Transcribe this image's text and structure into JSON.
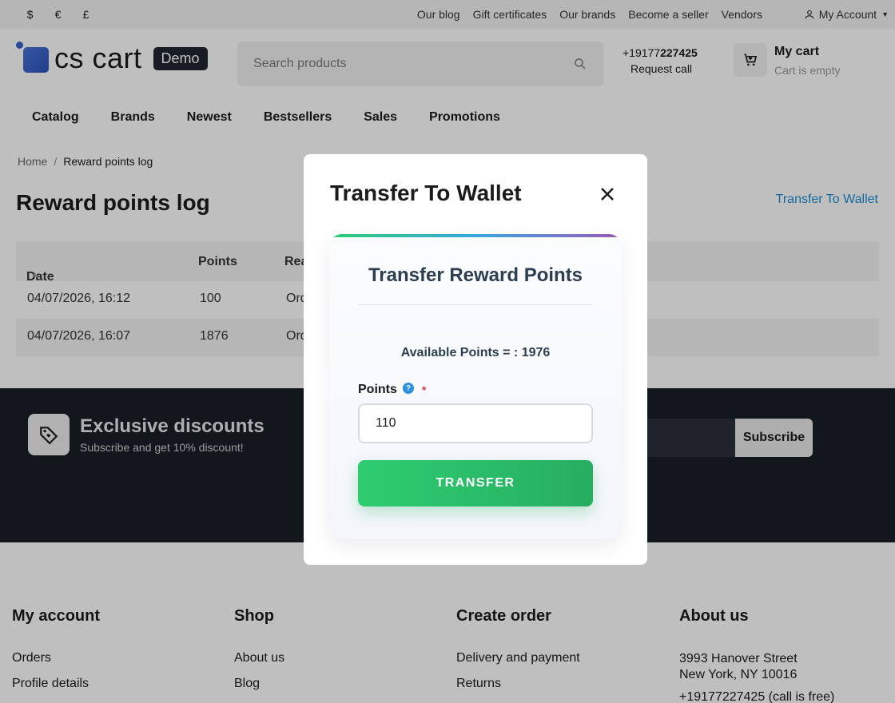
{
  "topbar": {
    "currencies": [
      "$",
      "€",
      "£"
    ],
    "links": [
      "Our blog",
      "Gift certificates",
      "Our brands",
      "Become a seller",
      "Vendors"
    ],
    "account_label": "My Account"
  },
  "header": {
    "logo_text": "cs cart",
    "logo_badge": "Demo",
    "search_placeholder": "Search products",
    "phone_prefix": "+19177",
    "phone_bold": "227425",
    "request_call": "Request call",
    "cart_title": "My cart",
    "cart_status": "Cart is empty"
  },
  "nav": [
    "Catalog",
    "Brands",
    "Newest",
    "Bestsellers",
    "Sales",
    "Promotions"
  ],
  "breadcrumb": {
    "home": "Home",
    "separator": "/",
    "current": "Reward points log"
  },
  "page": {
    "title": "Reward points log",
    "transfer_link": "Transfer To Wallet"
  },
  "table": {
    "headers": {
      "date": "Date",
      "points": "Points",
      "reason": "Rea"
    },
    "rows": [
      {
        "date": "04/07/2026, 16:12",
        "points": "100",
        "reason": "Ord"
      },
      {
        "date": "04/07/2026, 16:07",
        "points": "1876",
        "reason": "Ord"
      }
    ]
  },
  "newsletter": {
    "title": "Exclusive discounts",
    "subtitle": "Subscribe and get 10% discount!",
    "button": "Subscribe"
  },
  "footer": {
    "col1": {
      "title": "My account",
      "links": [
        "Orders",
        "Profile details"
      ]
    },
    "col2": {
      "title": "Shop",
      "links": [
        "About us",
        "Blog"
      ]
    },
    "col3": {
      "title": "Create order",
      "links": [
        "Delivery and payment",
        "Returns"
      ]
    },
    "col4": {
      "title": "About us",
      "address1": "3993 Hanover Street",
      "address2": "New York, NY 10016",
      "phone": "+19177227425 (call is free)"
    }
  },
  "modal": {
    "title": "Transfer To Wallet",
    "card_title": "Transfer Reward Points",
    "available": "Available Points = : 1976",
    "points_label": "Points",
    "help": "?",
    "required_mark": "*",
    "points_value": "110",
    "transfer_button": "TRANSFER"
  },
  "colors": {
    "accent_link": "#1a8fd8",
    "button_green": "#2ecc71",
    "dark_band": "#191f27"
  }
}
